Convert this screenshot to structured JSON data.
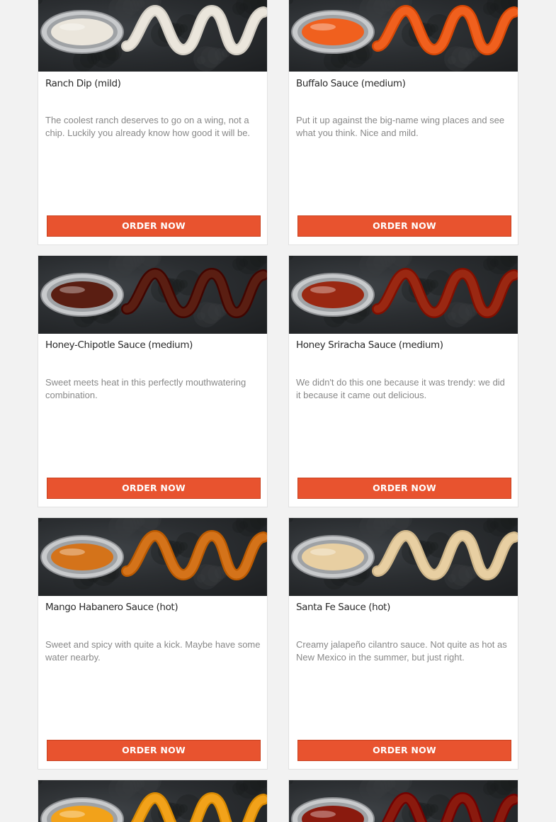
{
  "colors": {
    "page_background": "#f2f2f2",
    "card_background": "#ffffff",
    "button": "#e8532f",
    "title_text": "#2a2a2a",
    "description_text": "#888888"
  },
  "sauces": [
    {
      "title": "Ranch Dip (mild)",
      "description": "The coolest ranch deserves to go on a wing, not a chip. Luckily you already know how good it will be.",
      "button_label": "ORDER NOW",
      "sauce_color": "#ebe6dc",
      "image_icon": "ranch-dip-image"
    },
    {
      "title": "Buffalo Sauce (medium)",
      "description": "Put it up against the big-name wing places and see what you think. Nice and mild.",
      "button_label": "ORDER NOW",
      "sauce_color": "#f0601e",
      "image_icon": "buffalo-sauce-image"
    },
    {
      "title": "Honey-Chipotle Sauce (medium)",
      "description": "Sweet meets heat in this perfectly mouthwatering combination.",
      "button_label": "ORDER NOW",
      "sauce_color": "#5a1e12",
      "image_icon": "honey-chipotle-sauce-image"
    },
    {
      "title": "Honey Sriracha Sauce (medium)",
      "description": "We didn't do this one because it was trendy: we did it because it came out delicious.",
      "button_label": "ORDER NOW",
      "sauce_color": "#9a2812",
      "image_icon": "honey-sriracha-sauce-image"
    },
    {
      "title": "Mango Habanero Sauce (hot)",
      "description": "Sweet and spicy with quite a kick. Maybe have some water nearby.",
      "button_label": "ORDER NOW",
      "sauce_color": "#d4731a",
      "image_icon": "mango-habanero-sauce-image"
    },
    {
      "title": "Santa Fe Sauce (hot)",
      "description": "Creamy jalapeño cilantro sauce. Not quite as hot as New Mexico in the summer, but just right.",
      "button_label": "ORDER NOW",
      "sauce_color": "#e8cfa2",
      "image_icon": "santa-fe-sauce-image"
    },
    {
      "sauce_color": "#f2a21a",
      "image_icon": "yellow-sauce-image"
    },
    {
      "sauce_color": "#8a1a0e",
      "image_icon": "red-sauce-image"
    }
  ]
}
